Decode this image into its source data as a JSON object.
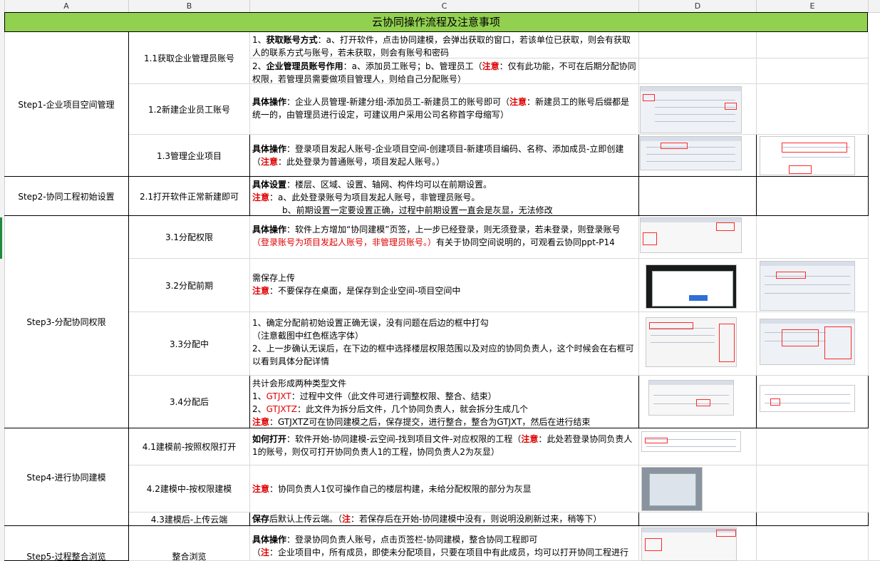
{
  "columns": [
    "A",
    "B",
    "C",
    "D",
    "E"
  ],
  "title": "云协同操作流程及注意事项",
  "steps": {
    "s1": "Step1-企业项目空间管理",
    "s2": "Step2-协同工程初始设置",
    "s3": "Step3-分配协同权限",
    "s4": "Step4-进行协同建模",
    "s5": "Step5-过程整合浏览"
  },
  "sub": {
    "r11": "1.1获取企业管理员账号",
    "r12": "1.2新建企业员工账号",
    "r13": "1.3管理企业项目",
    "r21": "2.1打开软件正常新建即可",
    "r31": "3.1分配权限",
    "r32": "3.2分配前期",
    "r33": "3.3分配中",
    "r34": "3.4分配后",
    "r41": "4.1建模前-按照权限打开",
    "r42": "4.2建模中-按权限建模",
    "r43": "4.3建模后-上传云端",
    "r51": "整合浏览"
  },
  "desc": {
    "r11a_1": "1、",
    "r11a_2": "获取账号方式",
    "r11a_3": "：a、打开软件，点击协同建模，会弹出获取的窗口，若该单位已获取，则会有获取人的联系方式与账号，若未获取，则会有账号和密码",
    "r11b_1": "2、",
    "r11b_2": "企业管理员账号作用",
    "r11b_3": "：a、添加员工账号；b、管理员工（",
    "r11b_4": "注意",
    "r11b_5": "：仅有此功能，不可在后期分配协同权限，若管理员需要做项目管理人，则给自己分配账号）",
    "r12_1": "具体操作",
    "r12_2": "：企业人员管理-新建分组-添加员工-新建员工的账号即可（",
    "r12_3": "注意",
    "r12_4": "：新建员工的账号后缀都是统一的，由管理员进行设定，可建议用户采用公司名称首字母缩写）",
    "r13_1": "具体操作",
    "r13_2": "：登录项目发起人账号-企业项目空间-创建项目-新建项目编码、名称、添加成员-立即创建",
    "r13_3": "（",
    "r13_4": "注意",
    "r13_5": "：此处登录为普通账号，项目发起人账号。）",
    "r21_1": "具体设置",
    "r21_2": "：楼层、区域、设置、轴网、构件均可以在前期设置。",
    "r21_3": "注意",
    "r21_4": "：a、此处登录账号为项目发起人账号，非管理员账号。",
    "r21_5": "b、前期设置一定要设置正确，过程中前期设置一直会是灰显，无法修改",
    "r31_1": "具体操作",
    "r31_2": "：软件上方增加“协同建模”页签，上一步已经登录，则无须登录，若未登录，则登录账号",
    "r31_3": "（登录账号为项目发起人账号，非管理员账号。）",
    "r31_4": "有关于协同空间说明的，可观看云协同ppt-P14",
    "r32_1": "需保存上传",
    "r32_2": "注意",
    "r32_3": "：不要保存在桌面，是保存到企业空间-项目空间中",
    "r33_1": "1、确定分配前初始设置正确无误，没有问题在后边的框中打勾",
    "r33_2": "（注意截图中红色框选字体）",
    "r33_3": "2、上一步确认无误后，在下边的框中选择楼层权限范围以及对应的协同负责人，这个时候会在右框可以看到具体分配详情",
    "r34_1": "共计会形成两种类型文件",
    "r34_2": "1、",
    "r34_3": "GTJXT",
    "r34_4": "：过程中文件（此文件可进行调整权限、整合、结束）",
    "r34_5": "2、",
    "r34_6": "GTJXTZ",
    "r34_7": "：此文件为拆分后文件，几个协同负责人，就会拆分生成几个",
    "r34_8": "注意",
    "r34_9": "：GTJXTZ可在协同建模之后，保存提交，进行整合，整合为GTJXT，然后在进行结束",
    "r41_1": "如何打开",
    "r41_2": "：软件开始-协同建模-云空间-找到项目文件-对应权限的工程（",
    "r41_3": "注意",
    "r41_4": "：此处若登录协同负责人1的账号，则仅可打开协同负责人1的工程，协同负责人2为灰显）",
    "r42_1": "注意",
    "r42_2": "：协同负责人1仅可操作自己的楼层构建，未给分配权限的部分为灰显",
    "r43_1": "保存",
    "r43_2": "后默认上传云端。（",
    "r43_3": "注",
    "r43_4": "：若保存后在开始-协同建模中没有，则说明没刷新过来，稍等下）",
    "r51_1": "具体操作",
    "r51_2": "：登录协同负责人账号，点击页签栏-协同建模，整合协同工程即可",
    "r51_3": "（",
    "r51_4": "注",
    "r51_5": "：企业项目中，所有成员，即使未分配项目，只要在项目中有此成员，均可以打开协同工程进行整"
  },
  "colors": {
    "title_bg": "#92d050",
    "note_red": "#e00000",
    "header_bg": "#f3f3f3",
    "grid": "#d9d9d9"
  }
}
